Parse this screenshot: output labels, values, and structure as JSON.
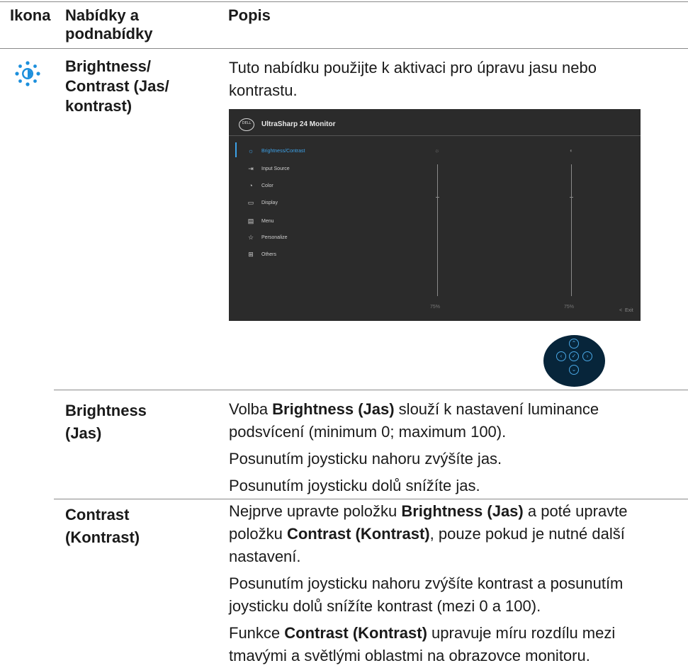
{
  "header": {
    "col_icon": "Ikona",
    "col_menu_line1": "Nabídky a",
    "col_menu_line2": "podnabídky",
    "col_desc": "Popis"
  },
  "row1": {
    "icon": "brightness-contrast-icon",
    "menu_lines": [
      "Brightness/",
      "Contrast (Jas/",
      "kontrast)"
    ],
    "desc_lines": [
      "Tuto nabídku použijte k aktivaci pro úpravu jasu nebo",
      "kontrastu."
    ]
  },
  "osd": {
    "logo": "DELL",
    "title": "UltraSharp 24 Monitor",
    "menu_items": [
      {
        "label": "Brightness/Contrast",
        "icon": "sun-icon",
        "active": true
      },
      {
        "label": "Input Source",
        "icon": "input-source-icon"
      },
      {
        "label": "Color",
        "icon": "color-palette-icon"
      },
      {
        "label": "Display",
        "icon": "display-icon"
      },
      {
        "label": "Menu",
        "icon": "menu-icon"
      },
      {
        "label": "Personalize",
        "icon": "star-icon"
      },
      {
        "label": "Others",
        "icon": "others-icon"
      }
    ],
    "brightness_value": "75%",
    "contrast_value": "75%",
    "brightness_level": 75,
    "contrast_level": 75,
    "exit_label": "Exit",
    "accent_color": "#3da2e8"
  },
  "joystick": {
    "buttons": [
      "up",
      "left",
      "select",
      "right",
      "down"
    ],
    "color": "#4aa8e6"
  },
  "row2": {
    "menu_lines": [
      "Brightness",
      "(Jas)"
    ],
    "p1_pre": "Volba ",
    "p1_bold": "Brightness (Jas)",
    "p1_post": " slouží k nastavení luminance",
    "p1_line2": "podsvícení (minimum 0; maximum 100).",
    "p2": "Posunutím joysticku nahoru zvýšíte jas.",
    "p3": "Posunutím joysticku dolů snížíte jas."
  },
  "row3": {
    "menu_lines": [
      "Contrast",
      "(Kontrast)"
    ],
    "p1_l1_pre": "Nejprve upravte položku ",
    "p1_l1_bold": "Brightness (Jas)",
    "p1_l1_post": " a poté upravte",
    "p1_l2_pre": "položku ",
    "p1_l2_bold": "Contrast (Kontrast)",
    "p1_l2_post": ", pouze pokud je nutné další",
    "p1_l3": "nastavení.",
    "p2_l1": "Posunutím joysticku nahoru zvýšíte kontrast a posunutím",
    "p2_l2": "joysticku dolů snížíte kontrast (mezi 0 a 100).",
    "p3_l1_pre": "Funkce ",
    "p3_l1_bold": "Contrast (Kontrast)",
    "p3_l1_post": " upravuje míru rozdílu mezi",
    "p3_l2": "tmavými a světlými oblastmi na obrazovce monitoru."
  }
}
